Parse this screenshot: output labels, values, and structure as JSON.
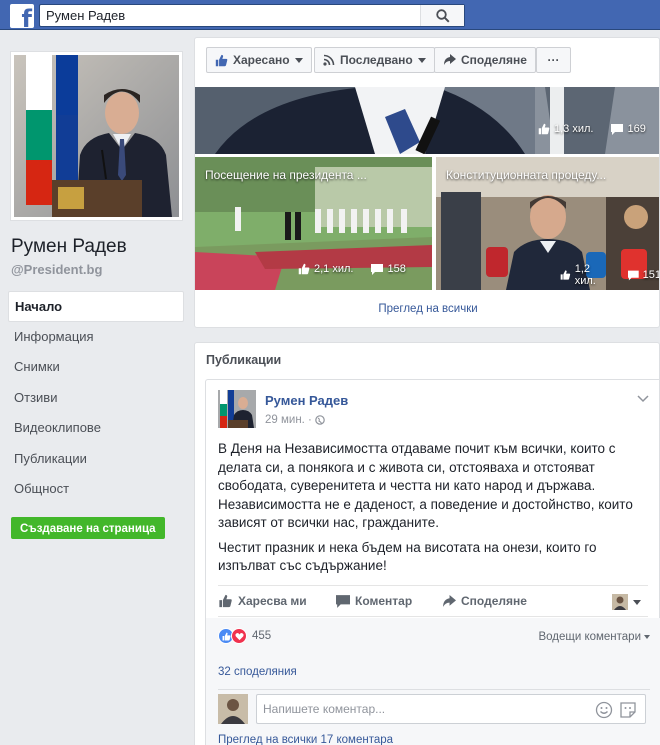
{
  "header": {
    "search_value": "Румен Радев"
  },
  "page": {
    "name": "Румен Радев",
    "handle": "@President.bg"
  },
  "nav": {
    "items": [
      "Начало",
      "Информация",
      "Снимки",
      "Отзиви",
      "Видеоклипове",
      "Публикации",
      "Общност"
    ],
    "create_page": "Създаване на страница"
  },
  "actions": {
    "like": "Харесано",
    "follow": "Последвано",
    "share": "Споделяне",
    "more": "···"
  },
  "videos": {
    "top": {
      "likes": "1,3 хил.",
      "comments": "169"
    },
    "tiles": [
      {
        "title": "Посещение на президента ...",
        "likes": "2,1 хил.",
        "comments": "158"
      },
      {
        "title": "Конституционната процеду...",
        "likes": "1,2 хил.",
        "comments": "151"
      }
    ],
    "see_all": "Преглед на всички"
  },
  "publications": {
    "title": "Публикации",
    "post": {
      "author": "Румен Радев",
      "time": "29 мин. ·",
      "paragraphs": [
        "В Деня на Независимостта отдаваме почит към всички, които с делата си, а понякога и с живота си, отстояваха и отстояват свободата, суверенитета и честта ни като народ и държава. Независимостта не е даденост, а поведение и достойнство, които зависят от всички нас, гражданите.",
        "Честит празник и нека бъдем на висотата на онези, които го изпълват със съдържание!"
      ],
      "like_label": "Харесва ми",
      "comment_label": "Коментар",
      "share_label": "Споделяне",
      "reactions_count": "455",
      "top_comments": "Водещи коментари",
      "shares": "32 споделяния",
      "comment_placeholder": "Напишете коментар...",
      "view_all_comments": "Преглед на всички 17 коментара"
    }
  },
  "colors": {
    "topbar": "#4267b2",
    "link": "#365899",
    "green": "#42b72a"
  }
}
